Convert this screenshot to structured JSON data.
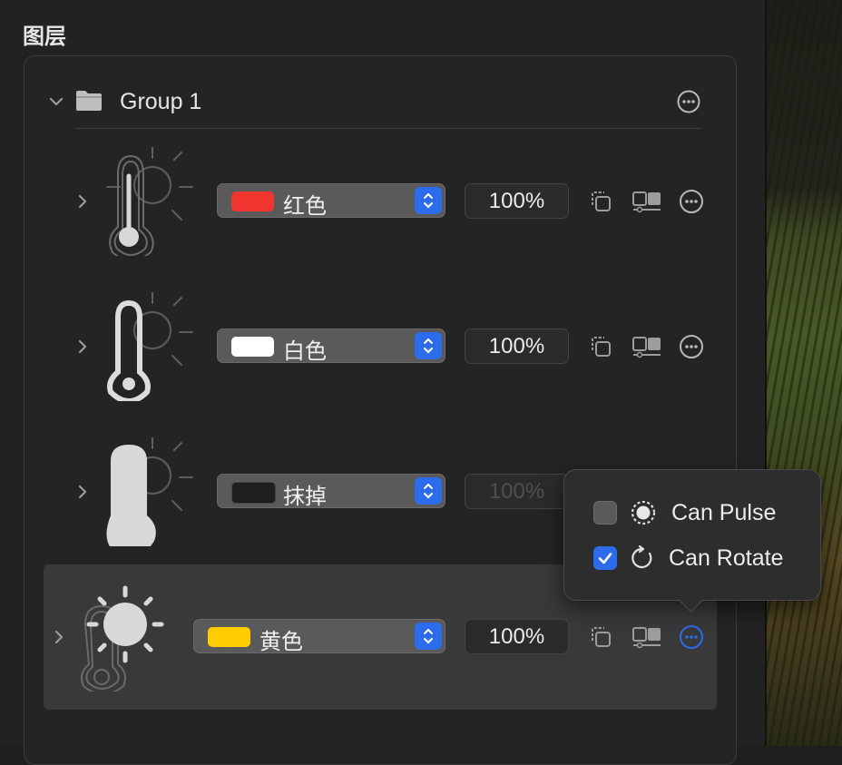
{
  "panel": {
    "title": "图层"
  },
  "group": {
    "name": "Group 1"
  },
  "layers": [
    {
      "color_name": "红色",
      "swatch": "#f0352f",
      "opacity": "100%",
      "icon": "thermometer-low-icon"
    },
    {
      "color_name": "白色",
      "swatch": "#ffffff",
      "opacity": "100%",
      "icon": "thermometer-outline-icon"
    },
    {
      "color_name": "抹掉",
      "swatch": "#1e1e1e",
      "opacity": "100%",
      "icon": "thermometer-filled-icon"
    },
    {
      "color_name": "黄色",
      "swatch": "#ffcc00",
      "opacity": "100%",
      "icon": "sun-icon"
    }
  ],
  "popover": {
    "can_pulse": {
      "label": "Can Pulse",
      "checked": false
    },
    "can_rotate": {
      "label": "Can Rotate",
      "checked": true
    }
  },
  "colors": {
    "accent": "#2c6bea",
    "background": "#222222"
  }
}
